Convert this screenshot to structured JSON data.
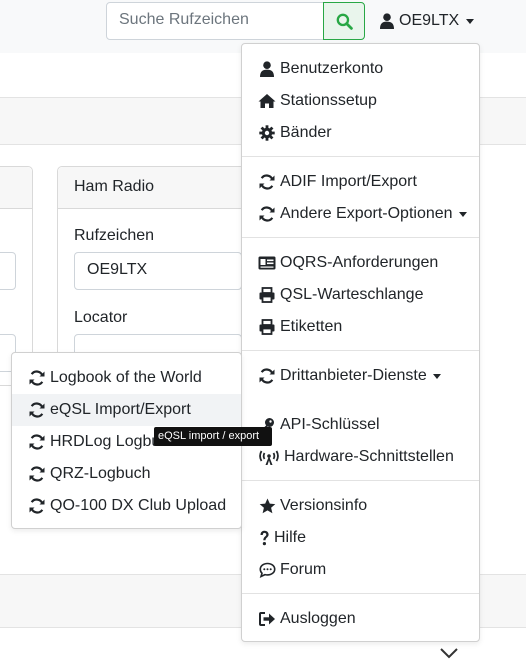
{
  "navbar": {
    "search_placeholder": "Suche Rufzeichen",
    "user_label": "OE9LTX"
  },
  "station_card": {
    "title": "Ham Radio",
    "callsign_label": "Rufzeichen",
    "callsign_value": "OE9LTX",
    "locator_label": "Locator"
  },
  "user_menu": {
    "items": [
      {
        "label": "Benutzerkonto",
        "icon": "user-icon"
      },
      {
        "label": "Stationssetup",
        "icon": "home-icon"
      },
      {
        "label": "Bänder",
        "icon": "gear-icon"
      },
      {
        "label": "ADIF Import/Export",
        "icon": "sync-icon"
      },
      {
        "label": "Andere Export-Optionen",
        "icon": "sync-icon"
      },
      {
        "label": "OQRS-Anforderungen",
        "icon": "id-card-icon"
      },
      {
        "label": "QSL-Warteschlange",
        "icon": "printer-icon"
      },
      {
        "label": "Etiketten",
        "icon": "printer-icon"
      },
      {
        "label": "Drittanbieter-Dienste",
        "icon": "sync-icon"
      },
      {
        "label": "API-Schlüssel",
        "icon": "key-icon"
      },
      {
        "label": "Hardware-Schnittstellen",
        "icon": "antenna-icon"
      },
      {
        "label": "Versionsinfo",
        "icon": "star-icon"
      },
      {
        "label": "Hilfe",
        "icon": "question-icon"
      },
      {
        "label": "Forum",
        "icon": "chat-icon"
      },
      {
        "label": "Ausloggen",
        "icon": "logout-icon"
      }
    ]
  },
  "third_party_menu": {
    "items": [
      {
        "label": "Logbook of the World",
        "icon": "sync-icon"
      },
      {
        "label": "eQSL Import/Export",
        "icon": "sync-icon"
      },
      {
        "label": "HRDLog Logbuch",
        "icon": "sync-icon"
      },
      {
        "label": "QRZ-Logbuch",
        "icon": "sync-icon"
      },
      {
        "label": "QO-100 DX Club Upload",
        "icon": "sync-icon"
      }
    ]
  },
  "tooltip": {
    "text": "eQSL import / export"
  },
  "colors": {
    "search_button_accent": "#28a745"
  }
}
